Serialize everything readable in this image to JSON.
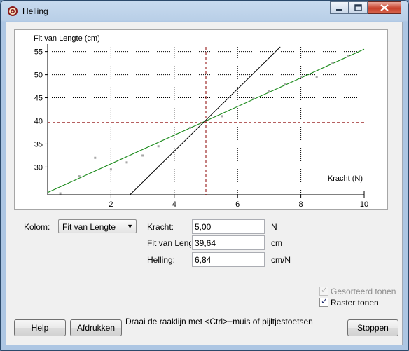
{
  "window": {
    "title": "Helling"
  },
  "chart_data": {
    "type": "scatter",
    "title": "",
    "xlabel": "Kracht (N)",
    "ylabel": "Fit van Lengte (cm)",
    "xlim": [
      0,
      10
    ],
    "ylim": [
      24,
      56
    ],
    "x_ticks": [
      2,
      4,
      6,
      8,
      10
    ],
    "y_ticks": [
      30,
      35,
      40,
      45,
      50,
      55
    ],
    "grid": true,
    "series": [
      {
        "type": "scatter",
        "points": [
          [
            0.4,
            24.3
          ],
          [
            1.0,
            28.0
          ],
          [
            1.5,
            32.0
          ],
          [
            2.0,
            29.5
          ],
          [
            2.5,
            31.0
          ],
          [
            3.0,
            32.5
          ],
          [
            3.5,
            34.5
          ],
          [
            4.5,
            38.5
          ],
          [
            5.5,
            41.0
          ],
          [
            6.5,
            45.0
          ],
          [
            7.0,
            46.5
          ],
          [
            7.5,
            48.0
          ],
          [
            8.0,
            49.5
          ],
          [
            8.5,
            49.5
          ],
          [
            9.0,
            52.5
          ],
          [
            9.5,
            54.0
          ]
        ]
      },
      {
        "type": "line",
        "points": [
          [
            0,
            24.5
          ],
          [
            10,
            55.5
          ]
        ]
      },
      {
        "type": "line",
        "points": [
          [
            2.6,
            24
          ],
          [
            7.35,
            56
          ]
        ]
      }
    ],
    "marker": {
      "x": 5.0,
      "y": 39.64
    },
    "colors": {
      "points": "#a7a7a7",
      "fit": "#1a8a1a",
      "tangent": "#000000",
      "marker": "#8b0000",
      "grid": "#000000"
    }
  },
  "controls": {
    "kolom_label": "Kolom:",
    "kolom_value": "Fit van Lengte",
    "kracht_label": "Kracht:",
    "kracht_value": "5,00",
    "kracht_unit": "N",
    "fit_label": "Fit van Lengte",
    "fit_value": "39,64",
    "fit_unit": "cm",
    "helling_label": "Helling:",
    "helling_value": "6,84",
    "helling_unit": "cm/N"
  },
  "options": {
    "sorted_label": "Gesorteerd tonen",
    "sorted_checked": true,
    "sorted_enabled": false,
    "grid_label": "Raster tonen",
    "grid_checked": true
  },
  "buttons": {
    "help": "Help",
    "print": "Afdrukken",
    "stop": "Stoppen"
  },
  "hint": "Draai de raaklijn met <Ctrl>+muis of pijltjestoetsen"
}
